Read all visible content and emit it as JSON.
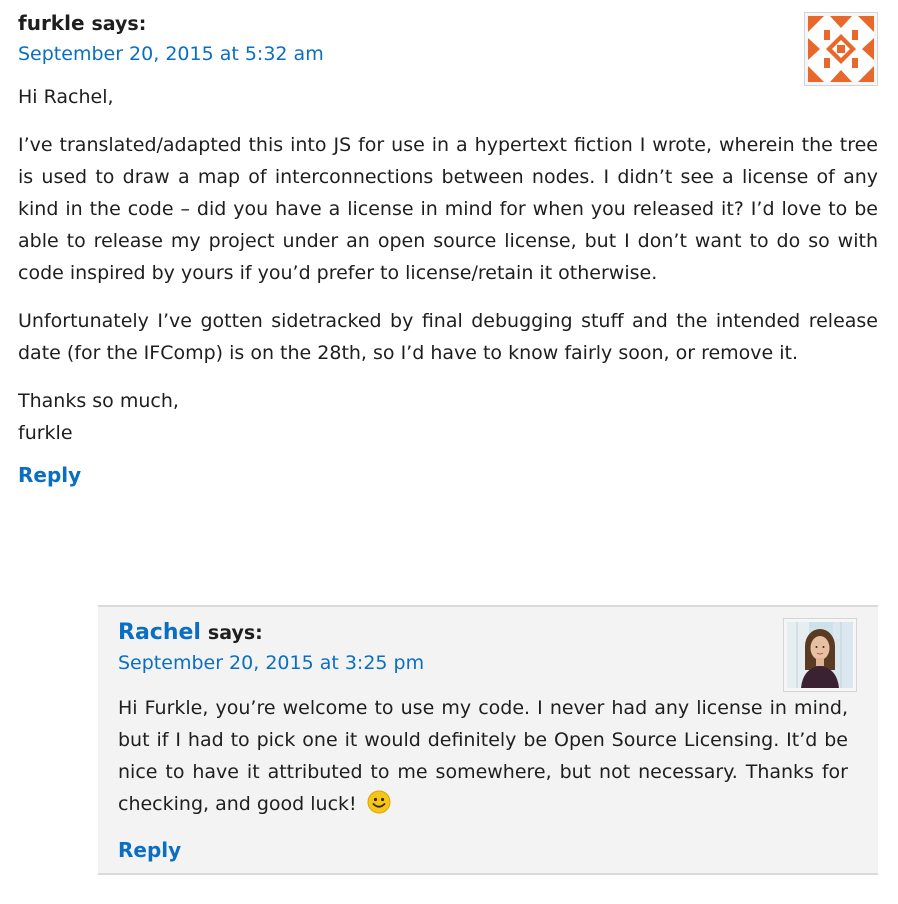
{
  "parent_comment": {
    "author": "furkle",
    "says": "says:",
    "date": "September 20, 2015 at 5:32 am",
    "avatar_icon": "geometric-identicon",
    "accent_color": "#e8672a",
    "paragraphs": [
      "Hi Rachel,",
      "I’ve translated/adapted this into JS for use in a hypertext fiction I wrote, wherein the tree is used to draw a map of interconnections between nodes. I didn’t see a license of any kind in the code – did you have a license in mind for when you released it? I’d love to be able to release my project under an open source license, but I don’t want to do so with code inspired by yours if you’d prefer to license/retain it otherwise.",
      "Unfortunately I’ve gotten sidetracked by final debugging stuff and the intended release date (for the IFComp) is on the 28th, so I’d have to know fairly soon, or remove it."
    ],
    "closing_line1": "Thanks so much,",
    "closing_line2": "furkle",
    "reply_label": "Reply"
  },
  "child_comment": {
    "author": "Rachel",
    "says": "says:",
    "date": "September 20, 2015 at 3:25 pm",
    "avatar_icon": "user-photo",
    "body": "Hi Furkle, you’re welcome to use my code. I never had any license in mind, but if I had to pick one it would definitely be Open Source Licensing. It’d be nice to have it attributed to me somewhere, but not necessary. Thanks for checking, and good luck!",
    "emoji": "🙂",
    "reply_label": "Reply"
  },
  "colors": {
    "link": "#0a6fc2",
    "child_background": "#f3f3f3"
  }
}
